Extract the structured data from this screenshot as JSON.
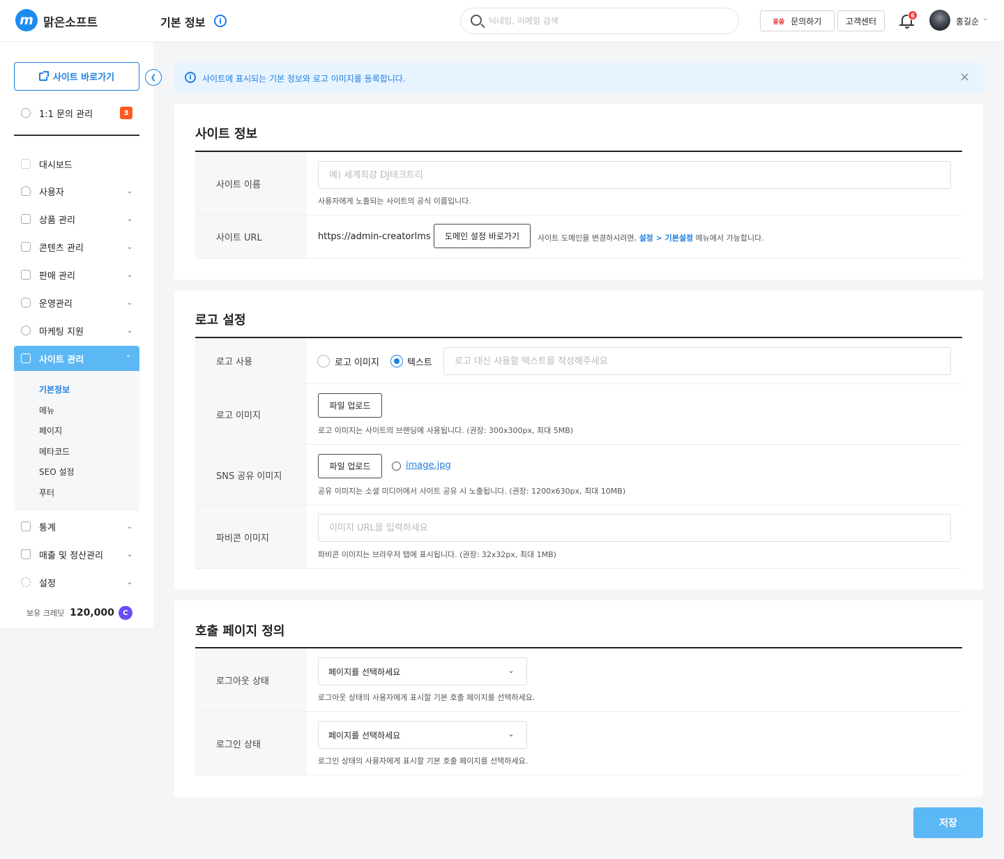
{
  "header": {
    "brand": "맑은소프트",
    "logo_letter": "m",
    "page_title": "기본 정보",
    "info_icon": "i",
    "search_placeholder": "닉네임, 이메일 검색",
    "ssam_label": "쏠쏠",
    "inquiry_label": "문의하기",
    "cs_label": "고객센터",
    "notif_count": "6",
    "username": "홍길순"
  },
  "sidebar": {
    "site_link": "사이트 바로가기",
    "inquiry": "1:1 문의 관리",
    "inquiry_count": "3",
    "items": [
      "대시보드",
      "사용자",
      "상품 관리",
      "콘텐츠 관리",
      "판매 관리",
      "운영관리",
      "마케팅 지원"
    ],
    "active": "사이트 관리",
    "submenu": [
      "기본정보",
      "메뉴",
      "페이지",
      "메타코드",
      "SEO 설정",
      "푸터"
    ],
    "bottom_items": [
      "통계",
      "매출 및 정산관리",
      "설정"
    ],
    "credit_label": "보유 크레딧",
    "credit_value": "120,000",
    "credit_icon": "C"
  },
  "alert": {
    "icon": "i",
    "text": "사이트에 표시되는 기본 정보와 로고 이미지를 등록합니다.",
    "close": "×"
  },
  "site_info": {
    "title": "사이트 정보",
    "name_label": "사이트 이름",
    "name_placeholder": "예) 세계최강 DJ테크트리",
    "name_hint": "사용자에게 노출되는 사이트의 공식 이름입니다.",
    "url_label": "사이트 URL",
    "url_value": "https://admin-creatorlms",
    "domain_button": "도메인 설정 바로가기",
    "url_hint_pre": "사이트 도메인을 변경하시려면,",
    "url_hint_link": "설정 > 기본설정",
    "url_hint_post": "메뉴에서 가능합니다."
  },
  "logo": {
    "title": "로고 설정",
    "use_label": "로고 사용",
    "option_image": "로고 이미지",
    "option_text": "텍스트",
    "selected": "텍스트",
    "text_placeholder": "로고 대신 사용할 텍스트를 작성해주세요",
    "image_label": "로고 이미지",
    "upload": "파일 업로드",
    "image_hint": "로고 이미지는 사이트의 브랜딩에 사용됩니다. (권장: 300x300px, 최대 5MB)",
    "sns_label": "SNS 공유 이미지",
    "sns_file": "image.jpg",
    "sns_hint": "공유 이미지는 소셜 미디어에서 사이트 공유 시 노출됩니다. (권장: 1200x630px, 최대 10MB)",
    "favicon_label": "파비콘 이미지",
    "favicon_placeholder": "이미지 URL을 입력하세요",
    "favicon_hint": "파비콘 이미지는 브라우저 탭에 표시됩니다. (권장: 32x32px, 최대 1MB)"
  },
  "landing": {
    "title": "호출 페이지 정의",
    "logout_label": "로그아웃 상태",
    "login_label": "로그인 상태",
    "select_placeholder": "페이지를 선택하세요",
    "logout_hint": "로그아웃 상태의 사용자에게 표시할 기본 호출 페이지를 선택하세요.",
    "login_hint": "로그인 상태의 사용자에게 표시할 기본 호출 페이지를 선택하세요."
  },
  "save": "저장",
  "colors": {
    "accent": "#1d7fe0",
    "active_bg": "#5cb8f5",
    "badge": "#ff5a1f",
    "credit": "#6c4cf5"
  }
}
